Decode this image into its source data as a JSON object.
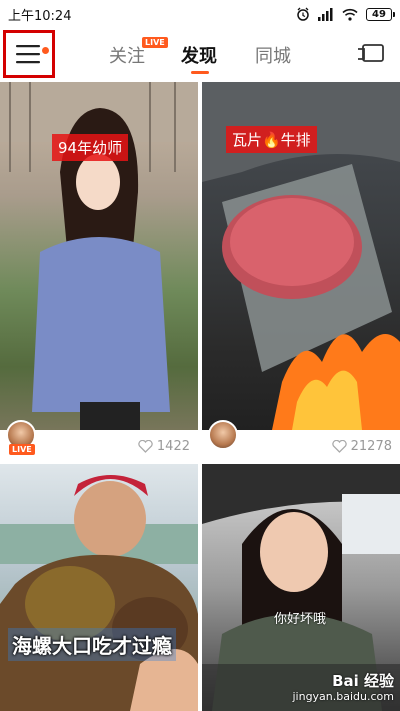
{
  "status_bar": {
    "time": "上午10:24",
    "battery": "49",
    "icons": [
      "alarm-icon",
      "signal-icon",
      "wifi-icon",
      "battery-icon"
    ]
  },
  "nav": {
    "menu_icon": "hamburger-menu-icon",
    "tabs": [
      {
        "label": "关注",
        "badge": "LIVE"
      },
      {
        "label": "发现",
        "active": true
      },
      {
        "label": "同城"
      }
    ],
    "cast_icon": "screen-cast-icon",
    "accent_color": "#ff5a1e"
  },
  "feed": {
    "cards": [
      {
        "caption": "94年幼师",
        "live_badge": "LIVE",
        "likes": "1422"
      },
      {
        "caption": "瓦片🔥牛排",
        "likes": "21278"
      },
      {
        "caption": "海螺大口吃才过瘾"
      },
      {
        "subtitle": "你好坏哦",
        "watermark": "Bai 经验",
        "watermark_url": "jingyan.baidu.com"
      }
    ]
  }
}
